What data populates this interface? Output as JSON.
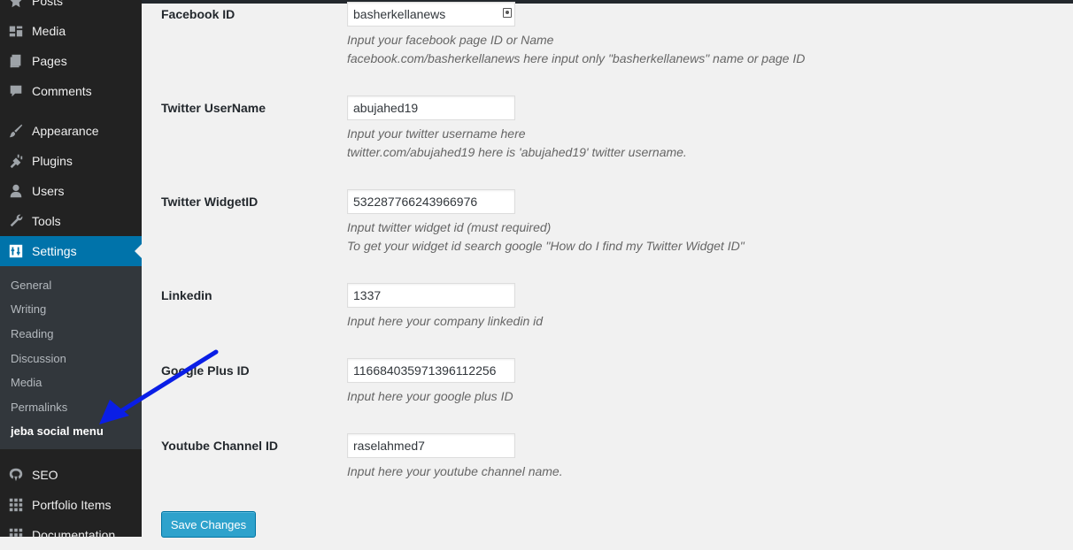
{
  "sidebar": {
    "top_items": [
      {
        "label": "Posts",
        "icon": "pin-icon"
      },
      {
        "label": "Media",
        "icon": "media-icon"
      },
      {
        "label": "Pages",
        "icon": "pages-icon"
      },
      {
        "label": "Comments",
        "icon": "comments-icon"
      },
      {
        "label": "Appearance",
        "icon": "paintbrush-icon"
      },
      {
        "label": "Plugins",
        "icon": "plugin-icon"
      },
      {
        "label": "Users",
        "icon": "users-icon"
      },
      {
        "label": "Tools",
        "icon": "wrench-icon"
      },
      {
        "label": "Settings",
        "icon": "settings-icon",
        "active": true
      }
    ],
    "submenu": [
      "General",
      "Writing",
      "Reading",
      "Discussion",
      "Media",
      "Permalinks",
      "jeba social menu"
    ],
    "bottom_items": [
      {
        "label": "SEO",
        "icon": "seo-icon"
      },
      {
        "label": "Portfolio Items",
        "icon": "grid-icon"
      },
      {
        "label": "Documentation",
        "icon": "grid-icon"
      }
    ]
  },
  "form": {
    "rows": [
      {
        "label": "Facebook ID",
        "value": "basherkellanews",
        "desc1": "Input your facebook page ID or Name",
        "desc2": "facebook.com/basherkellanews here input only \"basherkellanews\" name or page ID"
      },
      {
        "label": "Twitter UserName",
        "value": "abujahed19",
        "desc1": "Input your twitter username here",
        "desc2": "twitter.com/abujahed19 here is 'abujahed19' twitter username."
      },
      {
        "label": "Twitter WidgetID",
        "value": "532287766243966976",
        "desc1": "Input twitter widget id (must required)",
        "desc2": "To get your widget id search google \"How do I find my Twitter Widget ID\""
      },
      {
        "label": "Linkedin",
        "value": "1337",
        "desc1": "Input here your company linkedin id"
      },
      {
        "label": "Google Plus ID",
        "value": "116684035971396112256",
        "desc1": "Input here your google plus ID"
      },
      {
        "label": "Youtube Channel ID",
        "value": "raselahmed7",
        "desc1": "Input here your youtube channel name."
      }
    ],
    "save_label": "Save Changes"
  },
  "colors": {
    "sidebar_bg": "#222222",
    "submenu_bg": "#32373c",
    "active_blue": "#0073aa",
    "button_blue": "#2ea2cc",
    "annotation_arrow": "#0a1ee6"
  }
}
